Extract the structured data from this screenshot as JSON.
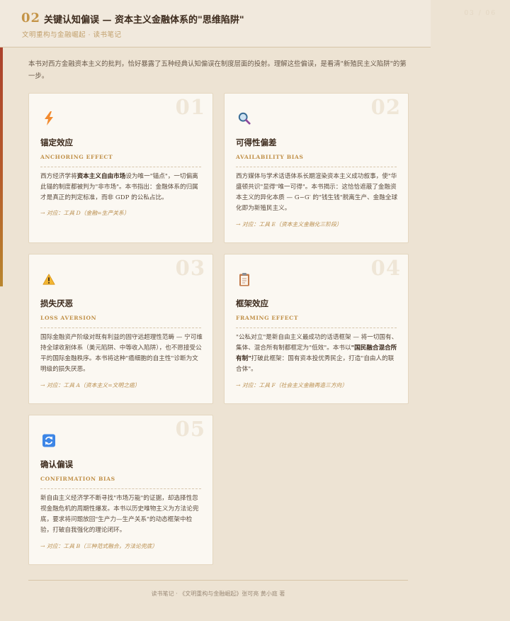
{
  "header": {
    "chapter_num": "02",
    "title": "关键认知偏误 — 资本主义金融体系的\"思维陷阱\"",
    "subtitle": "文明重构与金融崛起 · 读书笔记",
    "page_indicator": "03 / 06"
  },
  "intro": "本书对西方金融资本主义的批判，恰好暴露了五种经典认知偏误在制度层面的投射。理解这些偏误，是看清\"新殖民主义陷阱\"的第一步。",
  "cards": [
    {
      "num": "01",
      "icon": "lightning-icon",
      "title": "锚定效应",
      "en": "ANCHORING EFFECT",
      "body_html": "西方经济学将<b>资本主义自由市场</b>设为唯一\"锚点\"，一切偏离此锚的制度都被判为\"非市场\"。本书指出：金融体系的归属才是真正的判定标准，而非 GDP 的公私占比。",
      "ref": "→ 对应：工具 D（金融=生产关系）"
    },
    {
      "num": "02",
      "icon": "magnifier-icon",
      "title": "可得性偏差",
      "en": "AVAILABILITY BIAS",
      "body_html": "西方媒体与学术话语体系长期渲染资本主义成功叙事，使\"华盛顿共识\"显得\"唯一可得\"。本书揭示：这恰恰遮蔽了金融资本主义的异化本质 — G−G′ 的\"钱生钱\"脱离生产、金融全球化即为新殖民主义。",
      "ref": "→ 对应：工具 E（资本主义金融化三阶段）"
    },
    {
      "num": "03",
      "icon": "warning-icon",
      "title": "损失厌恶",
      "en": "LOSS AVERSION",
      "body_html": "国际金融资产阶级对既有利益的固守远超理性范畴 — 宁可维持全球收割体系（美元陷阱、中等收入陷阱），也不愿接受公平的国际金融秩序。本书将这种\"癌细胞的自主性\"诊断为文明级的损失厌恶。",
      "ref": "→ 对应：工具 A（资本主义=文明之癌）"
    },
    {
      "num": "04",
      "icon": "clipboard-icon",
      "title": "框架效应",
      "en": "FRAMING EFFECT",
      "body_html": "\"公私对立\"是新自由主义最成功的话语框架 — 将一切国有、集体、混合所有制都框定为\"低效\"。本书以<b>\"国民融合混合所有制\"</b>打破此框架：国有资本投优秀民企，打造\"自由人的联合体\"。",
      "ref": "→ 对应：工具 F（社会主义金融再造三方向）"
    },
    {
      "num": "05",
      "icon": "refresh-icon",
      "title": "确认偏误",
      "en": "CONFIRMATION BIAS",
      "body_html": "新自由主义经济学不断寻找\"市场万能\"的证据，却选择性忽视金融危机的周期性爆发。本书以历史唯物主义为方法论兜底，要求将问题放回\"生产力—生产关系\"的动态框架中检验，打破自我强化的理论闭环。",
      "ref": "→ 对应：工具 B（三种范式融合，方法论兜底）"
    }
  ],
  "footer": "读书笔记 · 《文明重构与金融崛起》张可亮 黄小庭 著",
  "colors": {
    "accent": "#c49447",
    "background": "#ede3d3",
    "card": "#fbf8f2"
  }
}
